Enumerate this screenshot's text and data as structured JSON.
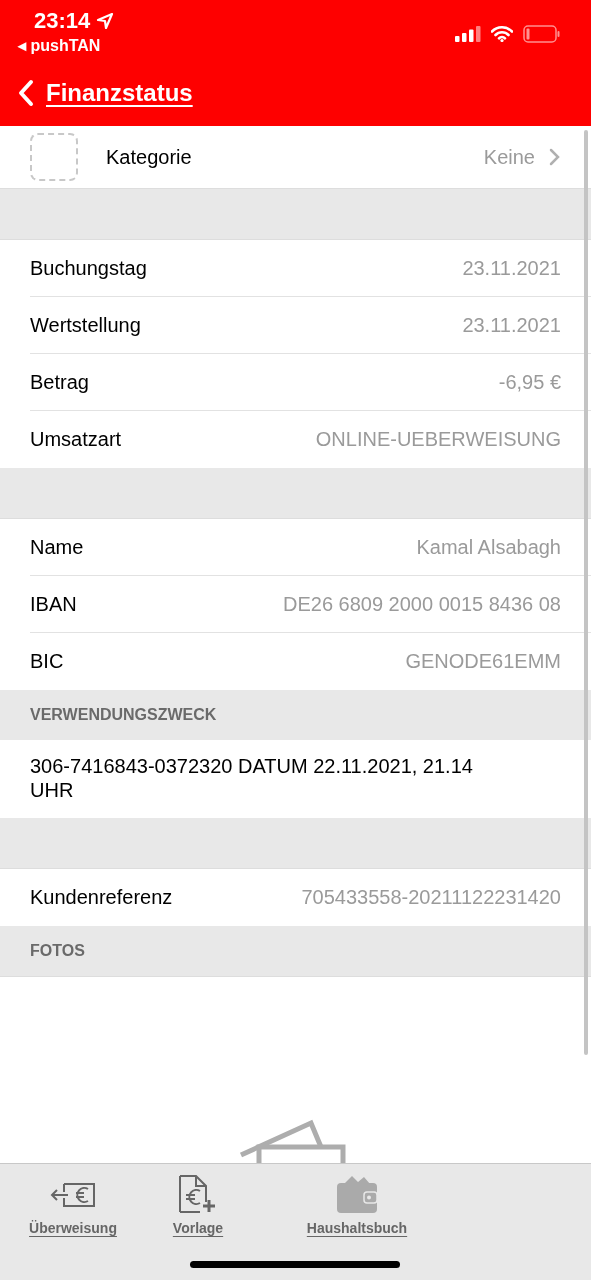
{
  "status_bar": {
    "time": "23:14",
    "back_app": "◂ pushTAN"
  },
  "nav": {
    "back_label": "Finanzstatus"
  },
  "category": {
    "label": "Kategorie",
    "value": "Keine"
  },
  "sections": [
    {
      "kind": "gap"
    },
    {
      "kind": "rows",
      "rows": [
        {
          "label": "Buchungstag",
          "value": "23.11.2021"
        },
        {
          "label": "Wertstellung",
          "value": "23.11.2021"
        },
        {
          "label": "Betrag",
          "value": "-6,95 €"
        },
        {
          "label": "Umsatzart",
          "value": "ONLINE-UEBERWEISUNG"
        }
      ]
    },
    {
      "kind": "gap"
    },
    {
      "kind": "rows",
      "rows": [
        {
          "label": "Name",
          "value": "Kamal Alsabagh"
        },
        {
          "label": "IBAN",
          "value": "DE26 6809 2000 0015 8436 08"
        },
        {
          "label": "BIC",
          "value": "GENODE61EMM"
        }
      ]
    },
    {
      "kind": "header",
      "title": "VERWENDUNGSZWECK"
    },
    {
      "kind": "text",
      "text": "306-7416843-0372320 DATUM 22.11.2021, 21.14 UHR"
    },
    {
      "kind": "gap"
    },
    {
      "kind": "rows",
      "rows": [
        {
          "label": "Kundenreferenz",
          "value": "705433558-20211122231420"
        }
      ]
    },
    {
      "kind": "header",
      "title": "FOTOS"
    },
    {
      "kind": "photos"
    }
  ],
  "tab_bar": [
    {
      "kind": "transfer",
      "label": "Überweisung"
    },
    {
      "kind": "template",
      "label": "Vorlage"
    },
    {
      "kind": "wallet",
      "label": "Haushaltsbuch"
    }
  ]
}
